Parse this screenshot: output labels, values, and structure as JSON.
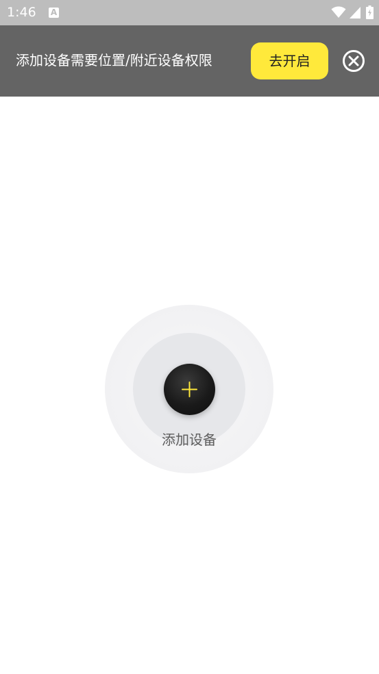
{
  "status_bar": {
    "time": "1:46",
    "notification_icon": "A",
    "icons": [
      "wifi-icon",
      "signal-icon",
      "battery-icon"
    ]
  },
  "permission_banner": {
    "message": "添加设备需要位置/附近设备权限",
    "enable_label": "去开启",
    "close_icon": "close-circle-icon"
  },
  "add_device": {
    "icon": "plus-icon",
    "label": "添加设备"
  },
  "colors": {
    "banner_bg": "#646464",
    "accent_yellow": "#ffe93b",
    "status_bar_bg": "#bdbdbd"
  }
}
